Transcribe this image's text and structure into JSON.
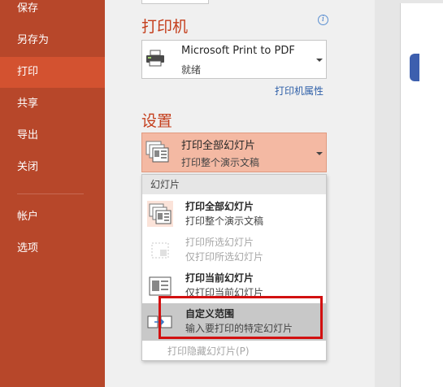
{
  "nav": {
    "items": [
      {
        "label": "保存"
      },
      {
        "label": "另存为"
      },
      {
        "label": "打印"
      },
      {
        "label": "共享"
      },
      {
        "label": "导出"
      },
      {
        "label": "关闭"
      },
      {
        "label": "帐户"
      },
      {
        "label": "选项"
      }
    ],
    "active_index": 2
  },
  "printer": {
    "section_title": "打印机",
    "info_icon": "i",
    "name": "Microsoft Print to PDF",
    "status": "就绪",
    "properties_link": "打印机属性"
  },
  "settings": {
    "section_title": "设置",
    "selected": {
      "title": "打印全部幻灯片",
      "subtitle": "打印整个演示文稿"
    }
  },
  "dropdown": {
    "header": "幻灯片",
    "options": [
      {
        "title": "打印全部幻灯片",
        "subtitle": "打印整个演示文稿",
        "state": "normal"
      },
      {
        "title": "打印所选幻灯片",
        "subtitle": "仅打印所选幻灯片",
        "state": "disabled"
      },
      {
        "title": "打印当前幻灯片",
        "subtitle": "仅打印当前幻灯片",
        "state": "normal"
      },
      {
        "title": "自定义范围",
        "subtitle": "输入要打印的特定幻灯片",
        "state": "selected"
      }
    ],
    "hidden_slides": "打印隐藏幻灯片(P)"
  },
  "colors": {
    "sidebar": "#b7472a",
    "sidebar_active": "#d35230",
    "accent": "#c43e1c",
    "selected_fill": "#f4b9a3",
    "highlight_box": "#d21010"
  }
}
